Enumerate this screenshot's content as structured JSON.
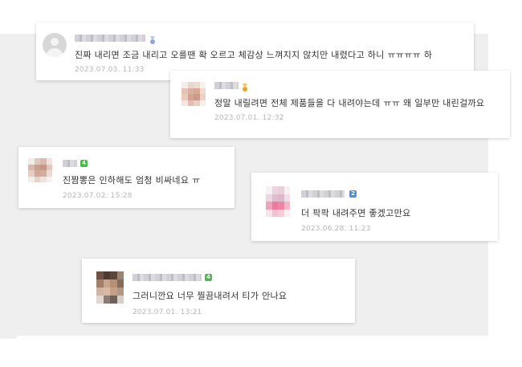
{
  "comments": [
    {
      "text": "진짜 내리면 조금 내리고 오를땐 확 오르고 체감상 느껴지지 않치만 내렸다고 하니 ㅠㅠㅠㅠ 하",
      "date": "2023.07.03. 11:33",
      "avatar": "default-user-icon",
      "badge_icon": "medal-icon",
      "badge_color": "#8aa7d8"
    },
    {
      "text": "정말 내릴려면 전체 제품들을 다 내려야는데 ㅠㅠ 왜 일부만 내린걸까요",
      "date": "2023.07.01. 12:32",
      "avatar": "blurred-avatar",
      "badge_icon": "medal-icon",
      "badge_color": "#f0a21c"
    },
    {
      "text": "진짬뽕은 인하해도 엄청 비싸네요 ㅠ",
      "date": "2023.07.02. 15:28",
      "avatar": "blurred-avatar",
      "badge": "4",
      "badge_color": "#4db84d"
    },
    {
      "text": "더 팍팍 내려주면 좋겠고만요",
      "date": "2023.06.28. 11:23",
      "avatar": "blurred-avatar",
      "badge": "2",
      "badge_color": "#4a90e2"
    },
    {
      "text": "그러니깐요 너무 찔끔내려서 티가 안나요",
      "date": "2023.07.01. 13:21",
      "avatar": "blurred-avatar",
      "badge": "4",
      "badge_color": "#4db84d"
    }
  ]
}
